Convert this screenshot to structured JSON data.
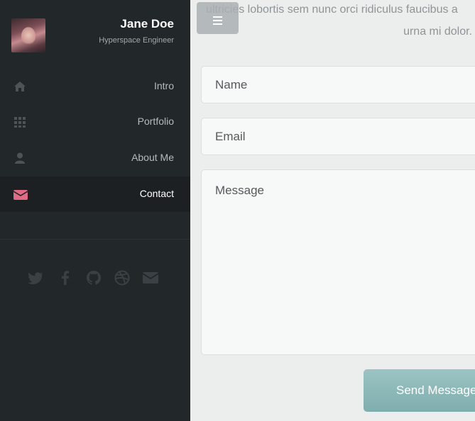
{
  "profile": {
    "name": "Jane Doe",
    "role": "Hyperspace Engineer",
    "avatar_icon": "avatar-photo"
  },
  "nav": {
    "items": [
      {
        "label": "Intro",
        "icon": "home-icon"
      },
      {
        "label": "Portfolio",
        "icon": "grid-icon"
      },
      {
        "label": "About Me",
        "icon": "user-icon"
      },
      {
        "label": "Contact",
        "icon": "envelope-icon",
        "active": true
      }
    ]
  },
  "social": {
    "icons": [
      "twitter-icon",
      "facebook-icon",
      "github-icon",
      "dribbble-icon",
      "envelope-icon"
    ]
  },
  "intro": {
    "line1": "ultricies lobortis sem nunc orci ridiculus faucibus a",
    "line2": "urna mi dolor."
  },
  "form": {
    "name_placeholder": "Name",
    "email_placeholder": "Email",
    "message_placeholder": "Message",
    "submit_label": "Send Message"
  },
  "colors": {
    "sidebar_bg": "#22272a",
    "active_bg": "#1c2023",
    "accent": "#e06b84",
    "button": "#8fb9b9"
  }
}
